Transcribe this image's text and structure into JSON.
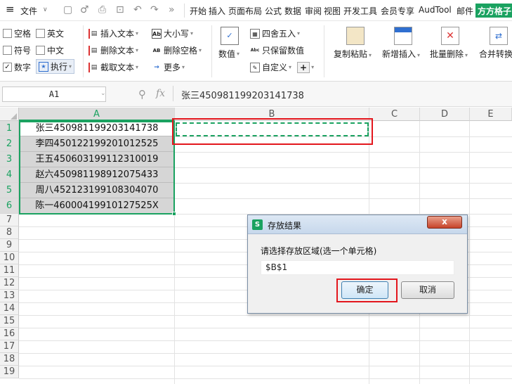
{
  "menubar": {
    "menu_label": "文件",
    "tabs": [
      "开始",
      "插入",
      "页面布局",
      "公式",
      "数据",
      "审阅",
      "视图",
      "开发工具",
      "会员专享",
      "AudTool",
      "邮件",
      "方方格子"
    ]
  },
  "ribbon": {
    "checkboxes": [
      {
        "label": "空格",
        "checked": false
      },
      {
        "label": "英文",
        "checked": false
      },
      {
        "label": "符号",
        "checked": false
      },
      {
        "label": "中文",
        "checked": false
      },
      {
        "label": "数字",
        "checked": true
      }
    ],
    "execute_label": "执行",
    "insert_text": "插入文本",
    "delete_text": "删除文本",
    "extract_text": "截取文本",
    "case_label": "大小写",
    "delete_space": "删除空格",
    "more_label": "更多",
    "numeric_label": "数值",
    "round_label": "四舍五入",
    "keep_values": "只保留数值",
    "custom_label": "自定义",
    "copy_paste": "复制粘贴",
    "add_insert": "新增插入",
    "batch_delete": "批量删除",
    "merge_convert": "合并转换",
    "icon_texts": {
      "ab": "Ab",
      "ab_small": "AB",
      "abc": "Abc",
      "plus": "+"
    }
  },
  "formula_bar": {
    "name_box": "A1",
    "fx_label": "fx",
    "content": "张三450981199203141738"
  },
  "sheet": {
    "columns": [
      "A",
      "B",
      "C",
      "D",
      "E"
    ],
    "rows": [
      "1",
      "2",
      "3",
      "4",
      "5",
      "6",
      "7",
      "8",
      "9",
      "10",
      "11",
      "12",
      "13",
      "14",
      "15",
      "16",
      "17",
      "18",
      "19"
    ],
    "column_a_values": [
      "张三450981199203141738",
      "李四450122199201012525",
      "王五450603199112310019",
      "赵六450981198912075433",
      "周八452123199108304070",
      "陈一46000419910127525X"
    ]
  },
  "dialog": {
    "title": "存放结果",
    "prompt": "请选择存放区域(选一个单元格)",
    "input_value": "$B$1",
    "ok_label": "确定",
    "cancel_label": "取消",
    "close_glyph": "x",
    "app_icon_glyph": "S"
  },
  "colors": {
    "accent_green": "#1aa260",
    "highlight_red": "#e3161d",
    "tab_active_bg": "#1aa260"
  }
}
